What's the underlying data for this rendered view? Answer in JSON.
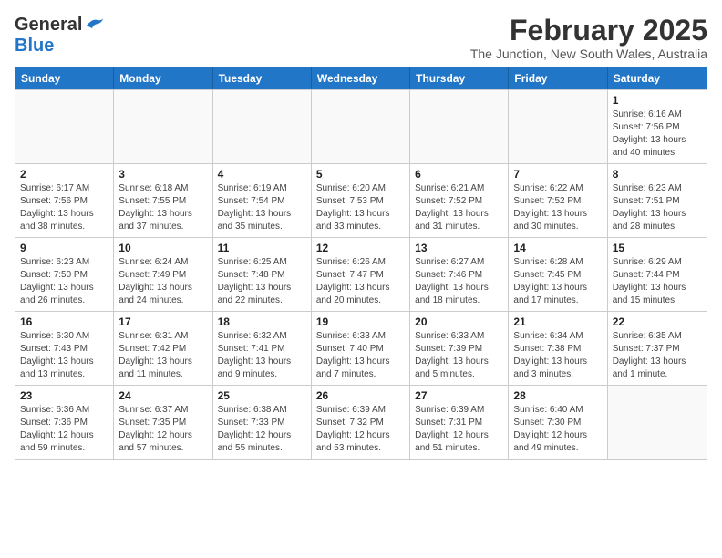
{
  "header": {
    "logo_general": "General",
    "logo_blue": "Blue",
    "title": "February 2025",
    "subtitle": "The Junction, New South Wales, Australia"
  },
  "days_of_week": [
    "Sunday",
    "Monday",
    "Tuesday",
    "Wednesday",
    "Thursday",
    "Friday",
    "Saturday"
  ],
  "weeks": [
    [
      {
        "day": "",
        "info": ""
      },
      {
        "day": "",
        "info": ""
      },
      {
        "day": "",
        "info": ""
      },
      {
        "day": "",
        "info": ""
      },
      {
        "day": "",
        "info": ""
      },
      {
        "day": "",
        "info": ""
      },
      {
        "day": "1",
        "info": "Sunrise: 6:16 AM\nSunset: 7:56 PM\nDaylight: 13 hours\nand 40 minutes."
      }
    ],
    [
      {
        "day": "2",
        "info": "Sunrise: 6:17 AM\nSunset: 7:56 PM\nDaylight: 13 hours\nand 38 minutes."
      },
      {
        "day": "3",
        "info": "Sunrise: 6:18 AM\nSunset: 7:55 PM\nDaylight: 13 hours\nand 37 minutes."
      },
      {
        "day": "4",
        "info": "Sunrise: 6:19 AM\nSunset: 7:54 PM\nDaylight: 13 hours\nand 35 minutes."
      },
      {
        "day": "5",
        "info": "Sunrise: 6:20 AM\nSunset: 7:53 PM\nDaylight: 13 hours\nand 33 minutes."
      },
      {
        "day": "6",
        "info": "Sunrise: 6:21 AM\nSunset: 7:52 PM\nDaylight: 13 hours\nand 31 minutes."
      },
      {
        "day": "7",
        "info": "Sunrise: 6:22 AM\nSunset: 7:52 PM\nDaylight: 13 hours\nand 30 minutes."
      },
      {
        "day": "8",
        "info": "Sunrise: 6:23 AM\nSunset: 7:51 PM\nDaylight: 13 hours\nand 28 minutes."
      }
    ],
    [
      {
        "day": "9",
        "info": "Sunrise: 6:23 AM\nSunset: 7:50 PM\nDaylight: 13 hours\nand 26 minutes."
      },
      {
        "day": "10",
        "info": "Sunrise: 6:24 AM\nSunset: 7:49 PM\nDaylight: 13 hours\nand 24 minutes."
      },
      {
        "day": "11",
        "info": "Sunrise: 6:25 AM\nSunset: 7:48 PM\nDaylight: 13 hours\nand 22 minutes."
      },
      {
        "day": "12",
        "info": "Sunrise: 6:26 AM\nSunset: 7:47 PM\nDaylight: 13 hours\nand 20 minutes."
      },
      {
        "day": "13",
        "info": "Sunrise: 6:27 AM\nSunset: 7:46 PM\nDaylight: 13 hours\nand 18 minutes."
      },
      {
        "day": "14",
        "info": "Sunrise: 6:28 AM\nSunset: 7:45 PM\nDaylight: 13 hours\nand 17 minutes."
      },
      {
        "day": "15",
        "info": "Sunrise: 6:29 AM\nSunset: 7:44 PM\nDaylight: 13 hours\nand 15 minutes."
      }
    ],
    [
      {
        "day": "16",
        "info": "Sunrise: 6:30 AM\nSunset: 7:43 PM\nDaylight: 13 hours\nand 13 minutes."
      },
      {
        "day": "17",
        "info": "Sunrise: 6:31 AM\nSunset: 7:42 PM\nDaylight: 13 hours\nand 11 minutes."
      },
      {
        "day": "18",
        "info": "Sunrise: 6:32 AM\nSunset: 7:41 PM\nDaylight: 13 hours\nand 9 minutes."
      },
      {
        "day": "19",
        "info": "Sunrise: 6:33 AM\nSunset: 7:40 PM\nDaylight: 13 hours\nand 7 minutes."
      },
      {
        "day": "20",
        "info": "Sunrise: 6:33 AM\nSunset: 7:39 PM\nDaylight: 13 hours\nand 5 minutes."
      },
      {
        "day": "21",
        "info": "Sunrise: 6:34 AM\nSunset: 7:38 PM\nDaylight: 13 hours\nand 3 minutes."
      },
      {
        "day": "22",
        "info": "Sunrise: 6:35 AM\nSunset: 7:37 PM\nDaylight: 13 hours\nand 1 minute."
      }
    ],
    [
      {
        "day": "23",
        "info": "Sunrise: 6:36 AM\nSunset: 7:36 PM\nDaylight: 12 hours\nand 59 minutes."
      },
      {
        "day": "24",
        "info": "Sunrise: 6:37 AM\nSunset: 7:35 PM\nDaylight: 12 hours\nand 57 minutes."
      },
      {
        "day": "25",
        "info": "Sunrise: 6:38 AM\nSunset: 7:33 PM\nDaylight: 12 hours\nand 55 minutes."
      },
      {
        "day": "26",
        "info": "Sunrise: 6:39 AM\nSunset: 7:32 PM\nDaylight: 12 hours\nand 53 minutes."
      },
      {
        "day": "27",
        "info": "Sunrise: 6:39 AM\nSunset: 7:31 PM\nDaylight: 12 hours\nand 51 minutes."
      },
      {
        "day": "28",
        "info": "Sunrise: 6:40 AM\nSunset: 7:30 PM\nDaylight: 12 hours\nand 49 minutes."
      },
      {
        "day": "",
        "info": ""
      }
    ]
  ]
}
